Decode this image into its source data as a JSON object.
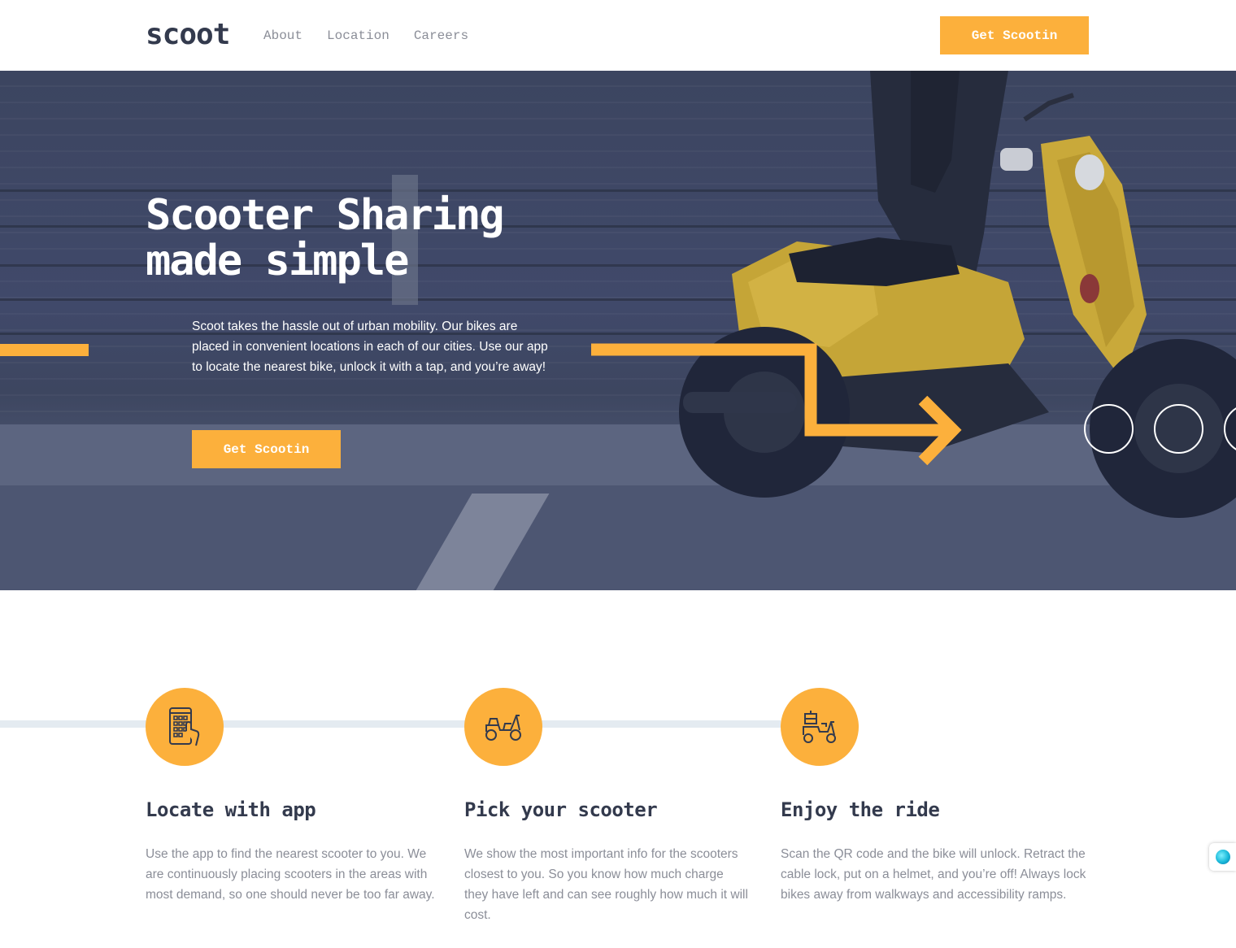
{
  "header": {
    "logo": "scoot",
    "nav": [
      "About",
      "Location",
      "Careers"
    ],
    "cta_label": "Get Scootin"
  },
  "hero": {
    "title": "Scooter Sharing\nmade simple",
    "text": "Scoot takes the hassle out of urban mobility. Our bikes are placed in convenient locations in each of our cities. Use our app to locate the nearest bike, unlock it with a tap, and you’re away!",
    "cta_label": "Get Scootin"
  },
  "steps": [
    {
      "icon": "phone-app-icon",
      "title": "Locate with app",
      "text": "Use the app to find the nearest scooter to you. We are continuously placing scooters in the areas with most demand, so one should never be too far away."
    },
    {
      "icon": "scooter-icon",
      "title": "Pick your scooter",
      "text": "We show the most important info for the scooters closest to you. So you know how much charge they have left and can see roughly how much it will cost."
    },
    {
      "icon": "delivery-scooter-icon",
      "title": "Enjoy the ride",
      "text": "Scan the QR code and the bike will unlock. Retract the cable lock, put on a helmet, and you’re off! Always lock bikes away from walkways and accessibility ramps."
    }
  ],
  "colors": {
    "accent": "#fcb03c",
    "navy": "#333a4d",
    "grey": "#8b8e98",
    "track": "#e4ebf1"
  }
}
